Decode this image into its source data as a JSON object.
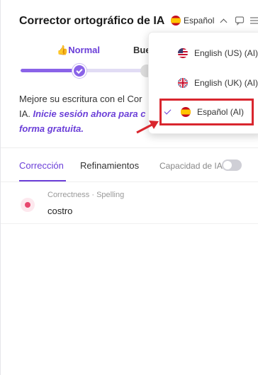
{
  "header": {
    "title": "Corrector ortográfico de IA",
    "language_selected": "Español"
  },
  "levels": {
    "normal_emoji": "👍",
    "normal_label": "Normal",
    "next_label": "Bue",
    "slider_fraction": 0.5
  },
  "promo": {
    "line1": "Mejore su escritura con el Cor",
    "line2_prefix": "IA. ",
    "line2_cta": "Inicie sesión ahora para c",
    "line3_cta": "forma gratuita."
  },
  "tabs": [
    {
      "label": "Corrección",
      "active": true
    },
    {
      "label": "Refinamientos",
      "active": false
    }
  ],
  "ai_capacity": {
    "label": "Capacidad de IA",
    "enabled": false
  },
  "issue": {
    "meta": "Correctness · Spelling",
    "word": "costro"
  },
  "language_menu": {
    "items": [
      {
        "label": "English (US) (AI)",
        "flag": "us-flag-icon",
        "selected": false
      },
      {
        "label": "English (UK) (AI)",
        "flag": "uk-flag-icon",
        "selected": false
      },
      {
        "label": "Español (AI)",
        "flag": "es-flag-icon",
        "selected": true
      }
    ]
  },
  "colors": {
    "accent": "#6b3fd8",
    "highlight": "#d9262e",
    "error_dot": "#e8486f"
  }
}
